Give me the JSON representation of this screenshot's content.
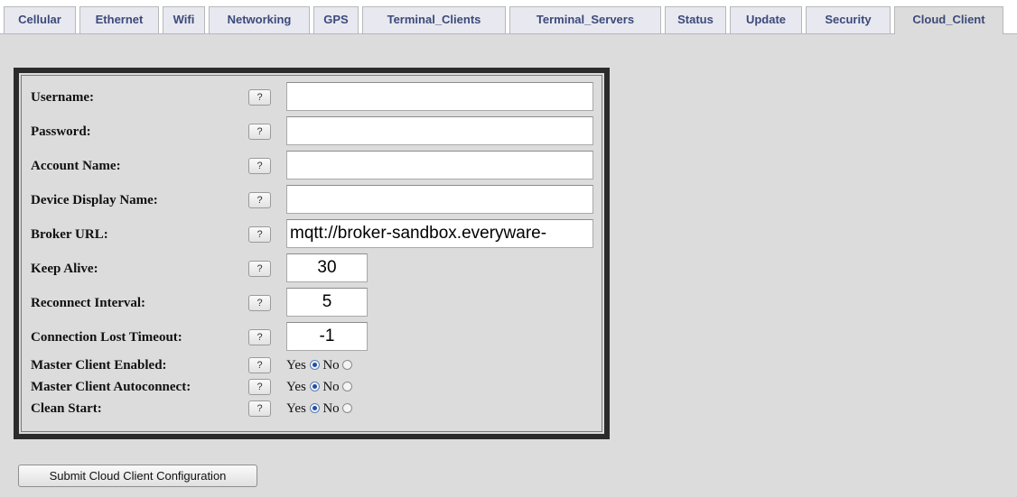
{
  "tabs": [
    {
      "label": "Cellular"
    },
    {
      "label": "Ethernet"
    },
    {
      "label": "Wifi"
    },
    {
      "label": "Networking"
    },
    {
      "label": "GPS"
    },
    {
      "label": "Terminal_Clients"
    },
    {
      "label": "Terminal_Servers"
    },
    {
      "label": "Status"
    },
    {
      "label": "Update"
    },
    {
      "label": "Security"
    },
    {
      "label": "Cloud_Client"
    }
  ],
  "active_tab": "Cloud_Client",
  "help_button_label": "?",
  "fields": {
    "username": {
      "label": "Username:",
      "value": ""
    },
    "password": {
      "label": "Password:",
      "value": ""
    },
    "account_name": {
      "label": "Account Name:",
      "value": ""
    },
    "device_display_name": {
      "label": "Device Display Name:",
      "value": ""
    },
    "broker_url": {
      "label": "Broker URL:",
      "value": "mqtt://broker-sandbox.everyware-"
    },
    "keep_alive": {
      "label": "Keep Alive:",
      "value": "30"
    },
    "reconnect_interval": {
      "label": "Reconnect Interval:",
      "value": "5"
    },
    "connection_lost_timeout": {
      "label": "Connection Lost Timeout:",
      "value": "-1"
    }
  },
  "toggles": {
    "master_client_enabled": {
      "label": "Master Client Enabled:",
      "selected": "Yes"
    },
    "master_client_autoconnect": {
      "label": "Master Client Autoconnect:",
      "selected": "Yes"
    },
    "clean_start": {
      "label": "Clean Start:",
      "selected": "Yes"
    }
  },
  "radio_labels": {
    "yes": "Yes",
    "no": "No"
  },
  "submit_label": "Submit Cloud Client Configuration"
}
